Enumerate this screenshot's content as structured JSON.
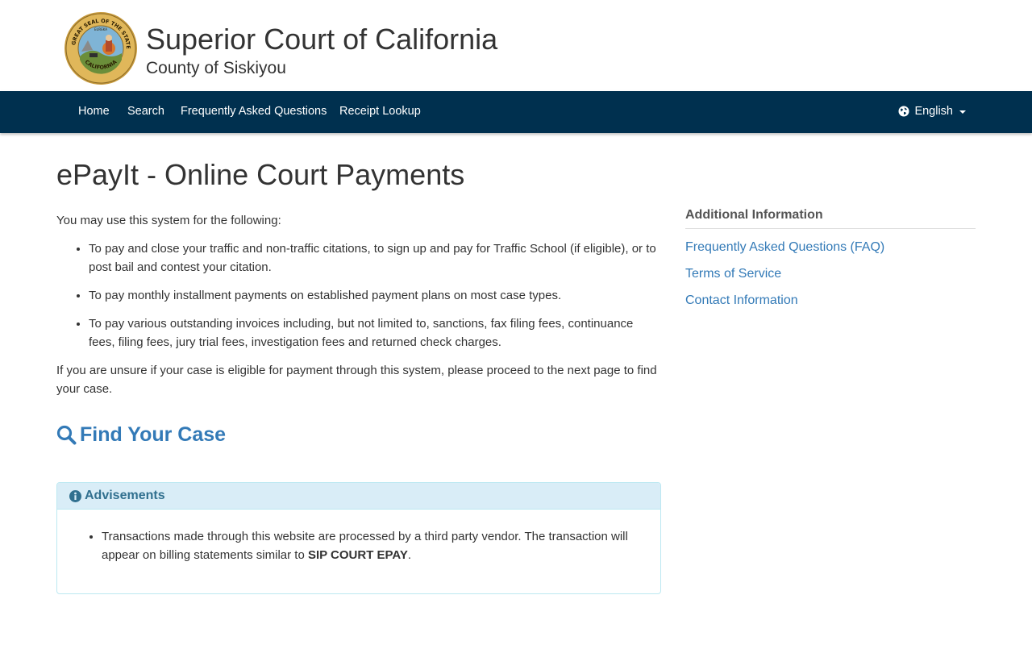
{
  "header": {
    "court_title": "Superior Court of California",
    "court_subtitle": "County of Siskiyou",
    "seal_top_text": "THE GREAT SEAL OF THE STATE OF",
    "seal_bottom_text": "CALIFORNIA",
    "seal_motto": "EUREKA"
  },
  "nav": {
    "items": [
      {
        "label": "Home"
      },
      {
        "label": "Search"
      },
      {
        "label": "Frequently Asked Questions"
      },
      {
        "label": "Receipt Lookup"
      }
    ],
    "language": "English",
    "language_icon": "globe-icon"
  },
  "page": {
    "title": "ePayIt - Online Court Payments",
    "intro": "You may use this system for the following:",
    "bullets": [
      "To pay and close your traffic and non-traffic citations, to sign up and pay for Traffic School (if eligible), or to post bail and contest your citation.",
      "To pay monthly installment payments on established payment plans on most case types.",
      "To pay various outstanding invoices including, but not limited to, sanctions, fax filing fees, continuance fees, filing fees, jury trial fees, investigation fees and returned check charges."
    ],
    "closing": "If you are unsure if your case is eligible for payment through this system, please proceed to the next page to find your case.",
    "find_case_label": "Find Your Case",
    "find_case_icon": "search-icon"
  },
  "advisements": {
    "heading": "Advisements",
    "heading_icon": "info-circle-icon",
    "item_text": "Transactions made through this website are processed by a third party vendor. The transaction will appear on billing statements similar to ",
    "item_bold": "SIP COURT EPAY",
    "item_end": "."
  },
  "sidebar": {
    "heading": "Additional Information",
    "links": [
      {
        "label": "Frequently Asked Questions (FAQ)"
      },
      {
        "label": "Terms of Service"
      },
      {
        "label": "Contact Information"
      }
    ]
  },
  "colors": {
    "navbar": "#00304f",
    "link": "#337ab7",
    "panel_heading_bg": "#d9edf7",
    "panel_border": "#bce8f1"
  }
}
